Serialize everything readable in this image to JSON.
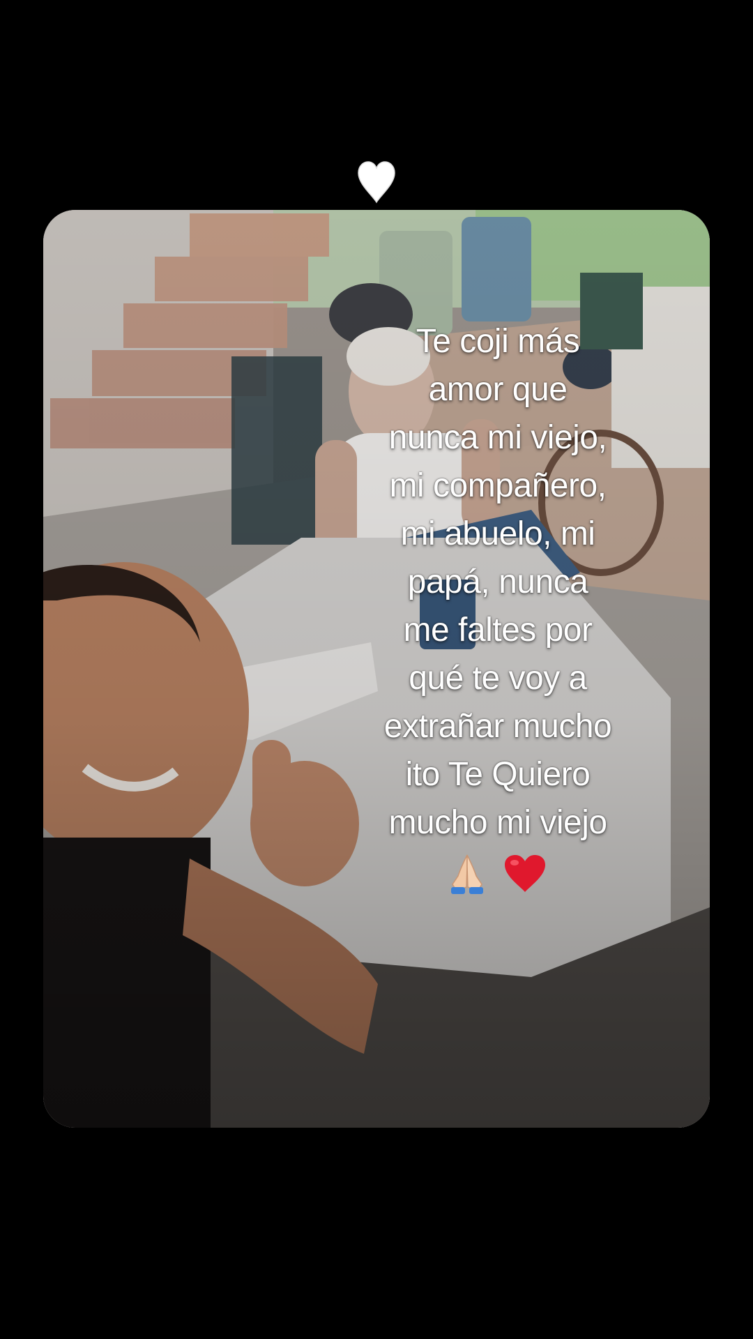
{
  "heart_icon": "white-heart-icon",
  "caption": {
    "lines": [
      "Te coji más",
      "amor que",
      "nunca mi viejo,",
      "mi compañero,",
      "mi abuelo, mi",
      "papá, nunca",
      "me faltes por",
      "qué te voy a",
      "extrañar mucho",
      "ito Te Quiero",
      "mucho mi viejo"
    ],
    "emojis": [
      "praying-hands-icon",
      "red-heart-icon"
    ]
  },
  "colors": {
    "background": "#000000",
    "caption_text": "#ffffff",
    "heart_top": "#ffffff",
    "red_heart": "#e0182d"
  }
}
